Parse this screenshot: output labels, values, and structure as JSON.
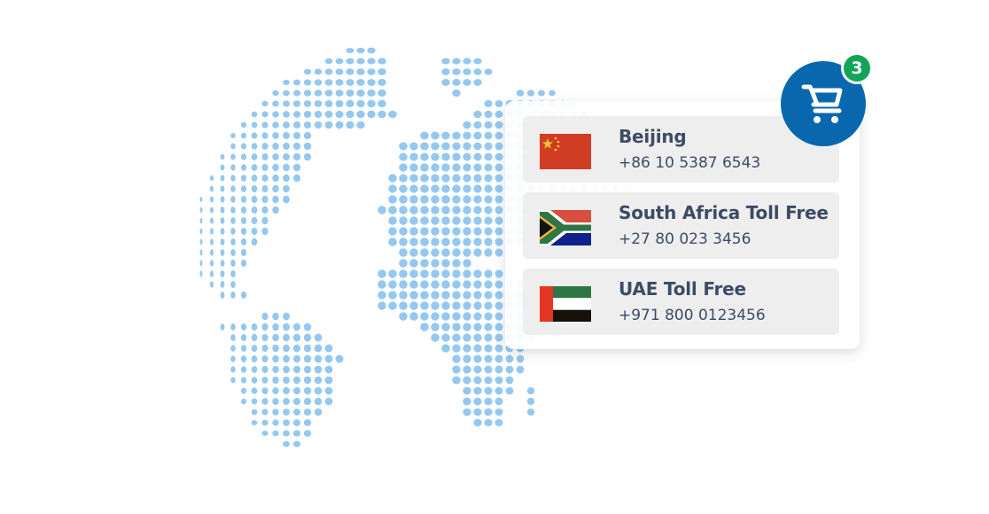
{
  "colors": {
    "map_dots": "#94c8f2",
    "tile_yellow": "#fdbd05",
    "tile_orange": "#e58306",
    "tile_blue": "#0980d6",
    "cart_bg": "#0867ad",
    "badge_bg": "#13a458",
    "text": "#3d4b63",
    "row_bg": "#eeeeef"
  },
  "cart": {
    "icon": "shopping-cart-icon",
    "badge_count": "3"
  },
  "numbers": [
    {
      "flag": "china-flag-icon",
      "name": "Beijing",
      "phone": "+86 10 5387 6543"
    },
    {
      "flag": "south-africa-flag-icon",
      "name": "South Africa Toll Free",
      "phone": "+27 80 023 3456"
    },
    {
      "flag": "uae-flag-icon",
      "name": "UAE Toll Free",
      "phone": "+971 800 0123456"
    }
  ]
}
